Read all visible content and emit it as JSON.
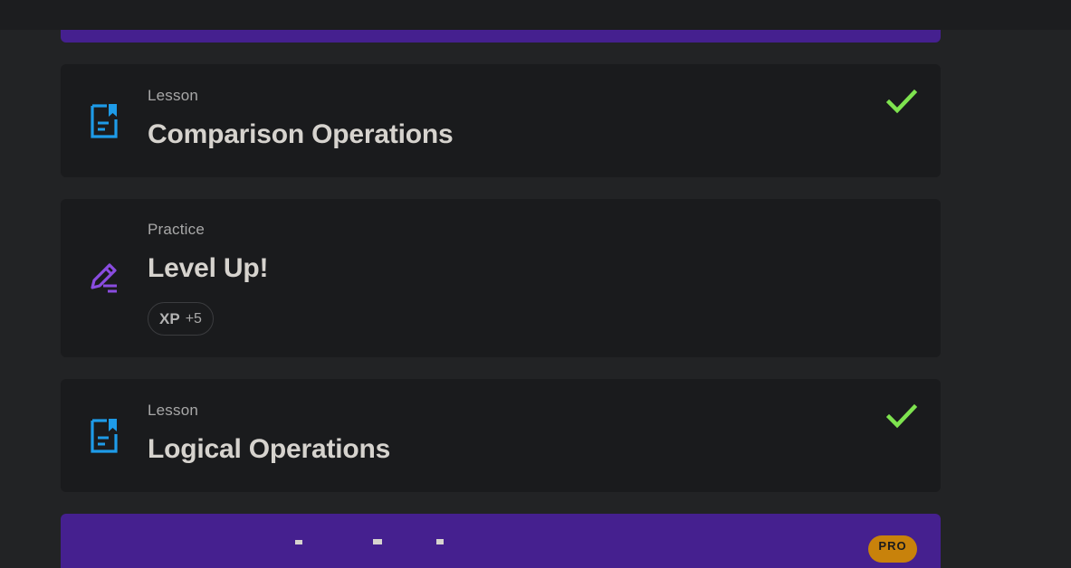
{
  "items": [
    {
      "kind": "Lesson",
      "title": "Comparison Operations",
      "completed": true,
      "icon": "lesson-document-icon"
    },
    {
      "kind": "Practice",
      "title": "Level Up!",
      "completed": false,
      "icon": "practice-pencil-icon",
      "xp": {
        "label": "XP",
        "value": "+5"
      }
    },
    {
      "kind": "Lesson",
      "title": "Logical Operations",
      "completed": true,
      "icon": "lesson-document-icon"
    }
  ],
  "next_module": {
    "badge": "PRO"
  },
  "colors": {
    "lesson_icon": "#1e9be8",
    "practice_icon": "#8a4ce0",
    "check": "#7ee34f",
    "module_bg": "#45208f",
    "pro_badge": "#c8820b"
  }
}
